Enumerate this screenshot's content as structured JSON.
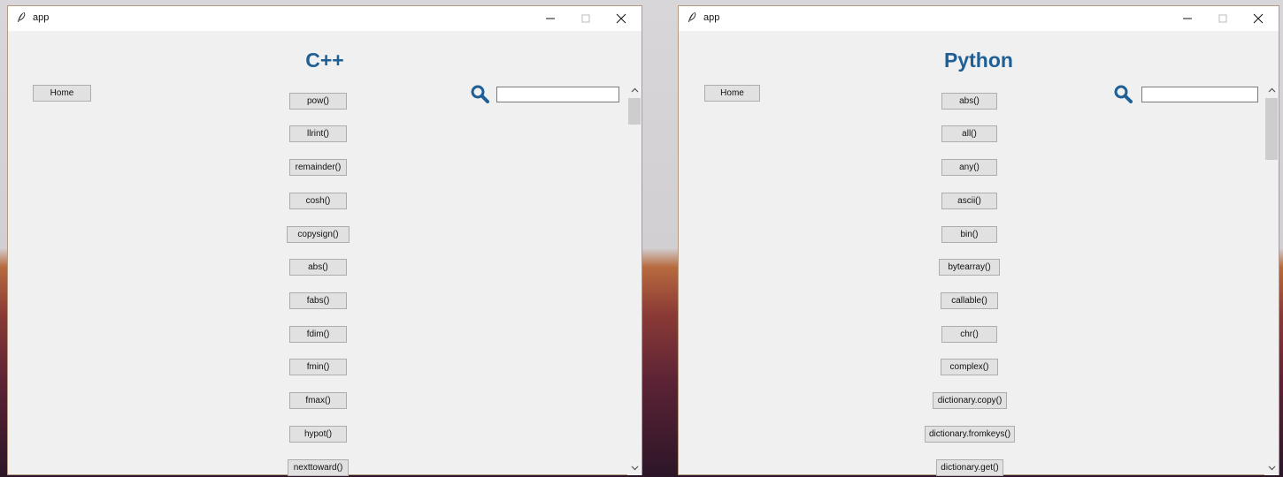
{
  "left_window": {
    "title": "app",
    "heading": "C++",
    "home_label": "Home",
    "search": {
      "value": "",
      "placeholder": ""
    },
    "functions": [
      "pow()",
      "llrint()",
      "remainder()",
      "cosh()",
      "copysign()",
      "abs()",
      "fabs()",
      "fdim()",
      "fmin()",
      "fmax()",
      "hypot()",
      "nexttoward()"
    ]
  },
  "right_window": {
    "title": "app",
    "heading": "Python",
    "home_label": "Home",
    "search": {
      "value": "",
      "placeholder": ""
    },
    "functions": [
      "abs()",
      "all()",
      "any()",
      "ascii()",
      "bin()",
      "bytearray()",
      "callable()",
      "chr()",
      "complex()",
      "dictionary.copy()",
      "dictionary.fromkeys()",
      "dictionary.get()"
    ]
  },
  "icons": {
    "app": "feather-icon",
    "minimize": "minimize-icon",
    "maximize": "maximize-icon",
    "close": "close-icon",
    "search": "search-icon",
    "scroll_up": "chevron-up-icon",
    "scroll_down": "chevron-down-icon"
  },
  "colors": {
    "heading": "#1e5f96",
    "search_icon": "#1e5f96",
    "window_bg": "#f0f0f0"
  }
}
